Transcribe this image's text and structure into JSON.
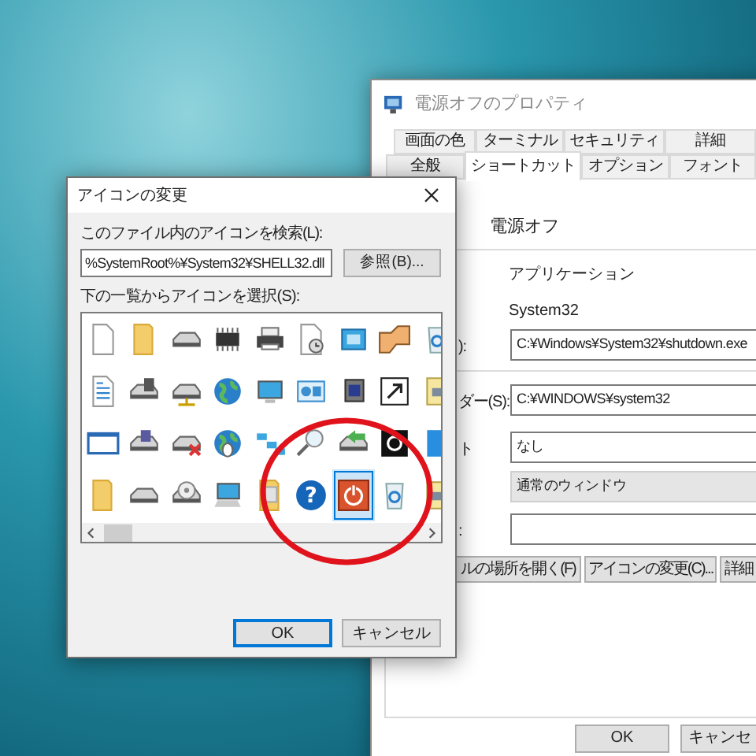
{
  "annotation": {
    "kind": "ellipse"
  },
  "properties_window": {
    "title": "電源オフのプロパティ",
    "tabs_back": [
      {
        "label": "画面の色",
        "selected": false
      },
      {
        "label": "ターミナル",
        "selected": false
      },
      {
        "label": "セキュリティ",
        "selected": false
      },
      {
        "label": "詳細",
        "selected": false
      }
    ],
    "tabs_front": [
      {
        "label": "全般",
        "selected": false
      },
      {
        "label": "ショートカット",
        "selected": true
      },
      {
        "label": "オプション",
        "selected": false
      },
      {
        "label": "フォント",
        "selected": false
      }
    ],
    "name": "電源オフ",
    "rows": [
      {
        "kind": "text",
        "value": "アプリケーション"
      },
      {
        "kind": "text",
        "value": "System32"
      },
      {
        "kind": "field",
        "label": "):",
        "value": "C:¥Windows¥System32¥shutdown.exe"
      },
      {
        "kind": "divider"
      },
      {
        "kind": "field",
        "label": "ダー(S):",
        "value": "C:¥WINDOWS¥system32"
      },
      {
        "kind": "field",
        "label": "ト",
        "value": "なし"
      },
      {
        "kind": "select",
        "value": "通常のウィンドウ"
      },
      {
        "kind": "field",
        "label": ":",
        "value": ""
      }
    ],
    "action_buttons": [
      "ルの場所を開く(F)",
      "アイコンの変更(C)...",
      "詳細"
    ],
    "buttons": [
      "OK",
      "キャンセ"
    ]
  },
  "icon_dialog": {
    "title": "アイコンの変更",
    "file_label": "このファイル内のアイコンを検索(L):",
    "file_value": "%SystemRoot%¥System32¥SHELL32.dll",
    "browse": "参照(B)...",
    "list_label": "下の一覧からアイコンを選択(S):",
    "icons": [
      [
        {
          "kind": "doc",
          "selected": false
        },
        {
          "kind": "folder",
          "selected": false
        },
        {
          "kind": "drive",
          "selected": false
        },
        {
          "kind": "chip",
          "selected": false
        },
        {
          "kind": "printer",
          "selected": false
        },
        {
          "kind": "clock-doc",
          "selected": false
        },
        {
          "kind": "window",
          "selected": false
        },
        {
          "kind": "hand",
          "selected": false
        },
        {
          "kind": "recycle",
          "selected": false
        }
      ],
      [
        {
          "kind": "text-doc",
          "selected": false
        },
        {
          "kind": "media",
          "selected": false
        },
        {
          "kind": "net-drive",
          "selected": false
        },
        {
          "kind": "globe",
          "selected": false
        },
        {
          "kind": "monitor",
          "selected": false
        },
        {
          "kind": "panel",
          "selected": false
        },
        {
          "kind": "device",
          "selected": false
        },
        {
          "kind": "shortcut",
          "selected": false
        },
        {
          "kind": "yellow-file",
          "selected": false
        }
      ],
      [
        {
          "kind": "window-frame",
          "selected": false
        },
        {
          "kind": "floppy",
          "selected": false
        },
        {
          "kind": "drive-x",
          "selected": false
        },
        {
          "kind": "globe-mouse",
          "selected": false
        },
        {
          "kind": "network",
          "selected": false
        },
        {
          "kind": "magnifier",
          "selected": false
        },
        {
          "kind": "arrow-drive",
          "selected": false
        },
        {
          "kind": "gear-badge",
          "selected": false
        },
        {
          "kind": "blue-square",
          "selected": false
        }
      ],
      [
        {
          "kind": "folder",
          "selected": false
        },
        {
          "kind": "drive",
          "selected": false
        },
        {
          "kind": "cd",
          "selected": false
        },
        {
          "kind": "computer",
          "selected": false
        },
        {
          "kind": "dot-folder",
          "selected": false
        },
        {
          "kind": "help",
          "glyph": "?",
          "selected": false
        },
        {
          "kind": "power",
          "selected": true
        },
        {
          "kind": "recycle",
          "selected": false
        },
        {
          "kind": "yellow-file",
          "selected": false
        }
      ]
    ],
    "buttons": [
      "OK",
      "キャンセル"
    ]
  }
}
